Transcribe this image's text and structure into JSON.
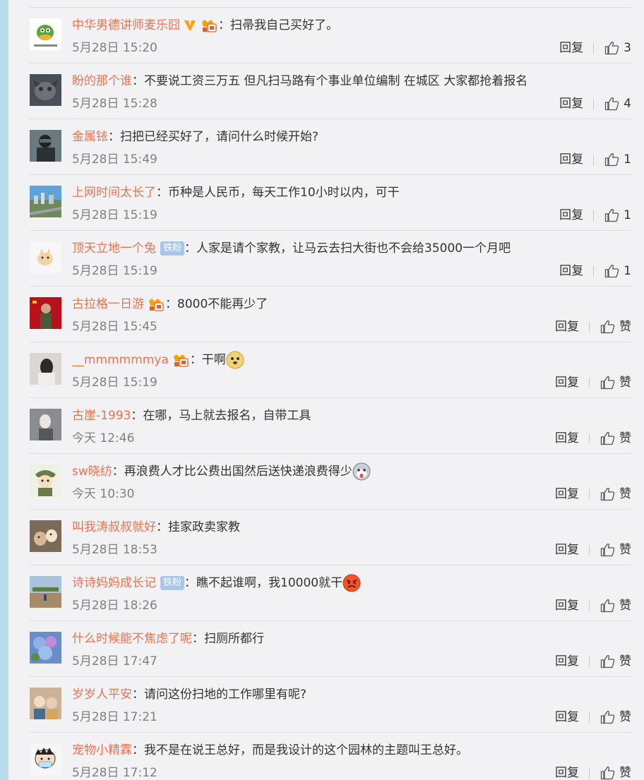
{
  "ui": {
    "reply_label": "回复",
    "like_label": "赞",
    "fan_badge": "铁粉"
  },
  "comments": [
    {
      "user": "中华男德讲师麦乐囧",
      "text": "扫帚我自己买好了。",
      "time": "5月28日 15:20",
      "likes": "3"
    },
    {
      "user": "盼的那个谁",
      "text": "不要说工资三万五 但凡扫马路有个事业单位编制 在城区 大家都抢着报名",
      "time": "5月28日 15:28",
      "likes": "4"
    },
    {
      "user": "金属铱",
      "text": "扫把已经买好了，请问什么时候开始?",
      "time": "5月28日 15:49",
      "likes": "1"
    },
    {
      "user": "上网时间太长了",
      "text": "币种是人民币，每天工作10小时以内，可干",
      "time": "5月28日 15:19",
      "likes": "1"
    },
    {
      "user": "顶天立地一个兔",
      "text": "人家是请个家教，让马云去扫大街也不会给35000一个月吧",
      "time": "5月28日 15:19",
      "likes": "1"
    },
    {
      "user": "古拉格一日游",
      "text": "8000不能再少了",
      "time": "5月28日 15:45",
      "likes": "赞"
    },
    {
      "user": "__mmmmmmya",
      "text": "干啊",
      "time": "5月28日 15:19",
      "likes": "赞"
    },
    {
      "user": "古崖-1993",
      "text": "在哪，马上就去报名，自带工具",
      "time": "今天 12:46",
      "likes": "赞"
    },
    {
      "user": "sw晓纺",
      "text": "再浪费人才比公费出国然后送快递浪费得少",
      "time": "今天 10:30",
      "likes": "赞"
    },
    {
      "user": "叫我涛叔叔就好",
      "text": "挂家政卖家教",
      "time": "5月28日 18:53",
      "likes": "赞"
    },
    {
      "user": "诗诗妈妈成长记",
      "text": "瞧不起谁啊，我10000就干",
      "time": "5月28日 18:26",
      "likes": "赞"
    },
    {
      "user": "什么时候能不焦虑了呢",
      "text": "扫厕所都行",
      "time": "5月28日 17:47",
      "likes": "赞"
    },
    {
      "user": "岁岁人平安",
      "text": "请问这份扫地的工作哪里有呢?",
      "time": "5月28日 17:21",
      "likes": "赞"
    },
    {
      "user": "宠物小精霖",
      "text": "我不是在说王总好，而是我设计的这个园林的主题叫王总好。",
      "time": "5月28日 17:12",
      "likes": "赞"
    }
  ],
  "colors": {
    "username": "#eb7350",
    "text": "#333333",
    "timestamp": "#808080",
    "fan_badge_bg": "#a8c6ea",
    "left_strip": "#b9dde8",
    "panel_bg": "#f2f2f5"
  }
}
